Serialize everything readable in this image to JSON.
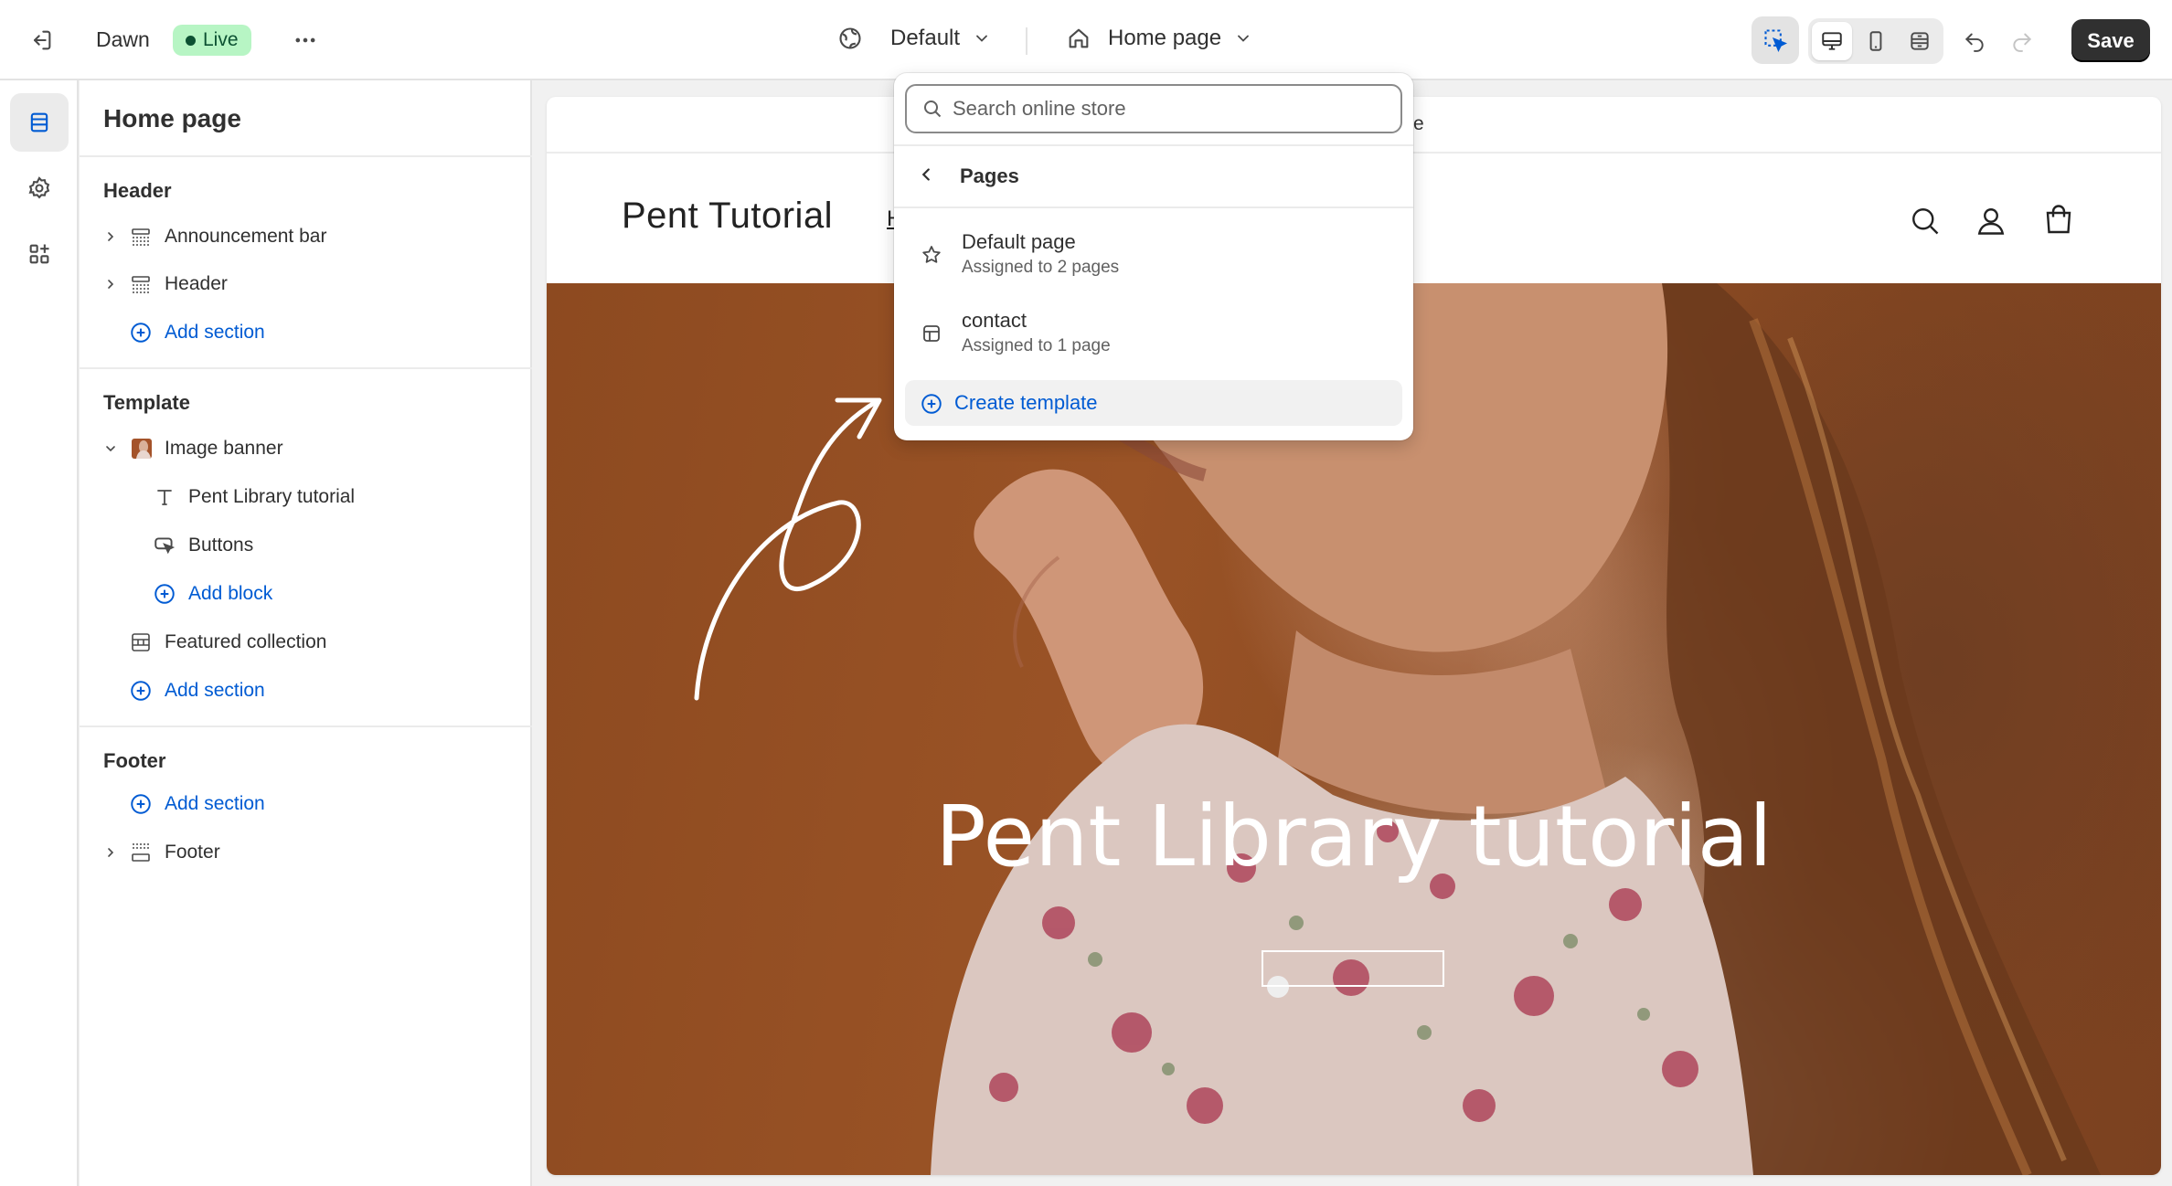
{
  "topbar": {
    "theme_name": "Dawn",
    "live_badge": "Live",
    "template_selector": "Default",
    "page_selector": "Home page",
    "save_label": "Save"
  },
  "sidebar": {
    "title": "Home page",
    "groups": {
      "header": {
        "title": "Header",
        "items": [
          "Announcement bar",
          "Header"
        ],
        "add_section": "Add section"
      },
      "template": {
        "title": "Template",
        "image_banner": "Image banner",
        "blocks": [
          "Pent Library tutorial",
          "Buttons"
        ],
        "add_block": "Add block",
        "featured_collection": "Featured collection",
        "add_section": "Add section"
      },
      "footer": {
        "title": "Footer",
        "add_section": "Add section",
        "items": [
          "Footer"
        ]
      }
    }
  },
  "dropdown": {
    "search_placeholder": "Search online store",
    "back_title": "Pages",
    "items": [
      {
        "name": "Default page",
        "sub": "Assigned to 2 pages"
      },
      {
        "name": "contact",
        "sub": "Assigned to 1 page"
      }
    ],
    "create_label": "Create template"
  },
  "preview": {
    "announcement_fragment": "tore",
    "store_name": "Pent Tutorial",
    "nav_fragment": "H",
    "banner_heading": "Pent Library tutorial"
  },
  "colors": {
    "accent_link": "#005bd3",
    "live_badge_bg": "#b7f5c4",
    "save_bg": "#303030",
    "banner_bg": "#8d4a20"
  }
}
